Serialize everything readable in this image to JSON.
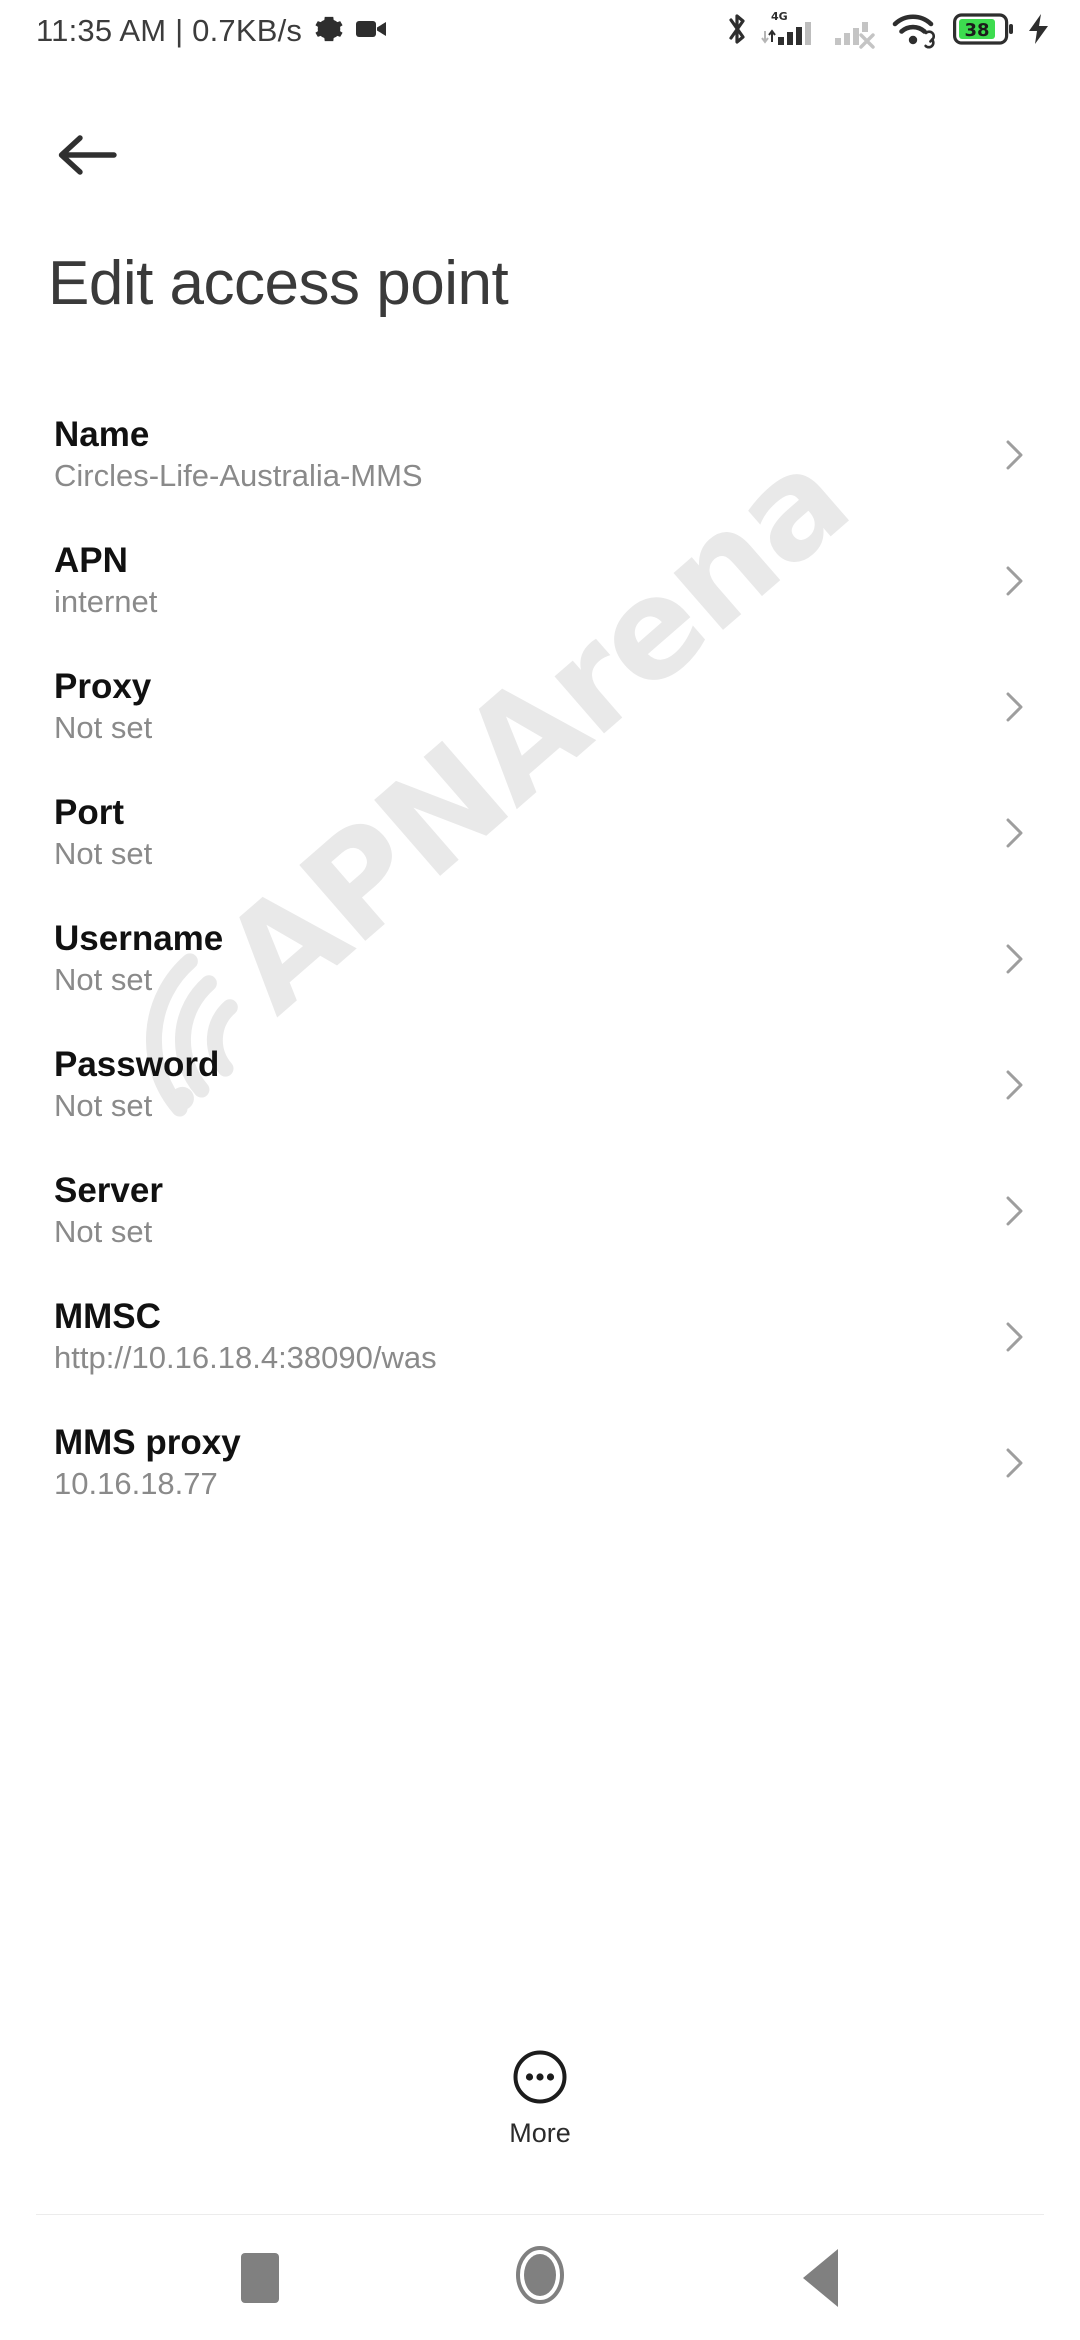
{
  "status_bar": {
    "clock_and_net": "11:35 AM | 0.7KB/s",
    "left_icons": [
      "gear-icon",
      "video-camera-icon"
    ],
    "right_icons": [
      "bluetooth-icon",
      "signal-4g-icon",
      "signal-no-service-icon",
      "wifi-icon",
      "battery-icon",
      "charging-bolt-icon"
    ],
    "network_type": "4G",
    "battery_level": "38",
    "charging": true
  },
  "header": {
    "back_icon": "arrow-left-icon",
    "title": "Edit access point"
  },
  "settings": {
    "rows": [
      {
        "label": "Name",
        "value": "Circles-Life-Australia-MMS"
      },
      {
        "label": "APN",
        "value": "internet"
      },
      {
        "label": "Proxy",
        "value": "Not set"
      },
      {
        "label": "Port",
        "value": "Not set"
      },
      {
        "label": "Username",
        "value": "Not set"
      },
      {
        "label": "Password",
        "value": "Not set"
      },
      {
        "label": "Server",
        "value": "Not set"
      },
      {
        "label": "MMSC",
        "value": "http://10.16.18.4:38090/was"
      },
      {
        "label": "MMS proxy",
        "value": "10.16.18.77"
      }
    ],
    "chevron_icon": "chevron-right-icon"
  },
  "more_button": {
    "label": "More",
    "icon": "more-dots-circle-icon"
  },
  "nav_bar": {
    "recents_label": "recents-button",
    "home_label": "home-button",
    "back_label": "back-button"
  },
  "watermark": {
    "text": "APNArena",
    "icon": "wifi-signal-icon",
    "color": "#e9e9e9"
  },
  "colors": {
    "background": "#ffffff",
    "label": "#111111",
    "value": "#8a8a8a",
    "title": "#3a3a3a",
    "chevron": "#9e9e9e",
    "battery_green": "#3ddc4f",
    "nav_gray": "#808080"
  }
}
